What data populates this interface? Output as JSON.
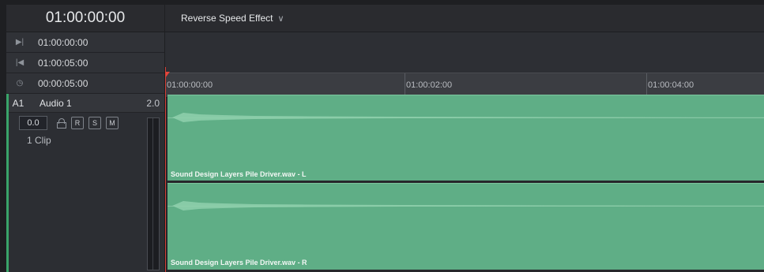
{
  "timecode": {
    "main": "01:00:00:00",
    "in_point": "01:00:00:00",
    "out_point": "01:00:05:00",
    "duration": "00:00:05:00"
  },
  "effect": {
    "label": "Reverse Speed Effect",
    "chevron_icon": "chevron-down-icon"
  },
  "ruler": {
    "labels": [
      "01:00:00:00",
      "01:00:02:00",
      "01:00:04:00"
    ]
  },
  "track": {
    "id": "A1",
    "name": "Audio 1",
    "format": "2.0",
    "volume": "0.0",
    "buttons": {
      "record": "R",
      "solo": "S",
      "mute": "M"
    },
    "clip_count": "1 Clip"
  },
  "clips": [
    {
      "name": "Sound Design Layers Pile Driver.wav - L"
    },
    {
      "name": "Sound Design Layers Pile Driver.wav - R"
    }
  ],
  "colors": {
    "clip_green": "#5fae86",
    "playhead_red": "#d64036"
  }
}
